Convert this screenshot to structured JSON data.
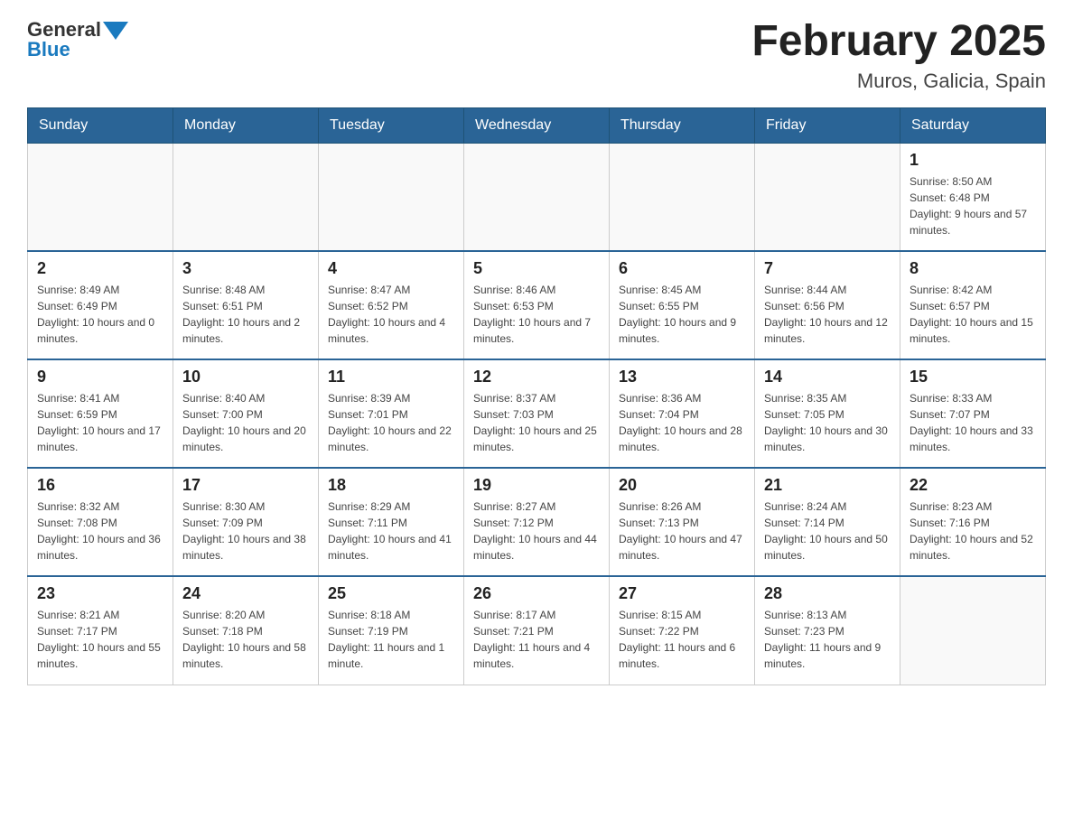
{
  "header": {
    "logo_general": "General",
    "logo_blue": "Blue",
    "title": "February 2025",
    "location": "Muros, Galicia, Spain"
  },
  "weekdays": [
    "Sunday",
    "Monday",
    "Tuesday",
    "Wednesday",
    "Thursday",
    "Friday",
    "Saturday"
  ],
  "weeks": [
    [
      {
        "day": "",
        "info": ""
      },
      {
        "day": "",
        "info": ""
      },
      {
        "day": "",
        "info": ""
      },
      {
        "day": "",
        "info": ""
      },
      {
        "day": "",
        "info": ""
      },
      {
        "day": "",
        "info": ""
      },
      {
        "day": "1",
        "info": "Sunrise: 8:50 AM\nSunset: 6:48 PM\nDaylight: 9 hours and 57 minutes."
      }
    ],
    [
      {
        "day": "2",
        "info": "Sunrise: 8:49 AM\nSunset: 6:49 PM\nDaylight: 10 hours and 0 minutes."
      },
      {
        "day": "3",
        "info": "Sunrise: 8:48 AM\nSunset: 6:51 PM\nDaylight: 10 hours and 2 minutes."
      },
      {
        "day": "4",
        "info": "Sunrise: 8:47 AM\nSunset: 6:52 PM\nDaylight: 10 hours and 4 minutes."
      },
      {
        "day": "5",
        "info": "Sunrise: 8:46 AM\nSunset: 6:53 PM\nDaylight: 10 hours and 7 minutes."
      },
      {
        "day": "6",
        "info": "Sunrise: 8:45 AM\nSunset: 6:55 PM\nDaylight: 10 hours and 9 minutes."
      },
      {
        "day": "7",
        "info": "Sunrise: 8:44 AM\nSunset: 6:56 PM\nDaylight: 10 hours and 12 minutes."
      },
      {
        "day": "8",
        "info": "Sunrise: 8:42 AM\nSunset: 6:57 PM\nDaylight: 10 hours and 15 minutes."
      }
    ],
    [
      {
        "day": "9",
        "info": "Sunrise: 8:41 AM\nSunset: 6:59 PM\nDaylight: 10 hours and 17 minutes."
      },
      {
        "day": "10",
        "info": "Sunrise: 8:40 AM\nSunset: 7:00 PM\nDaylight: 10 hours and 20 minutes."
      },
      {
        "day": "11",
        "info": "Sunrise: 8:39 AM\nSunset: 7:01 PM\nDaylight: 10 hours and 22 minutes."
      },
      {
        "day": "12",
        "info": "Sunrise: 8:37 AM\nSunset: 7:03 PM\nDaylight: 10 hours and 25 minutes."
      },
      {
        "day": "13",
        "info": "Sunrise: 8:36 AM\nSunset: 7:04 PM\nDaylight: 10 hours and 28 minutes."
      },
      {
        "day": "14",
        "info": "Sunrise: 8:35 AM\nSunset: 7:05 PM\nDaylight: 10 hours and 30 minutes."
      },
      {
        "day": "15",
        "info": "Sunrise: 8:33 AM\nSunset: 7:07 PM\nDaylight: 10 hours and 33 minutes."
      }
    ],
    [
      {
        "day": "16",
        "info": "Sunrise: 8:32 AM\nSunset: 7:08 PM\nDaylight: 10 hours and 36 minutes."
      },
      {
        "day": "17",
        "info": "Sunrise: 8:30 AM\nSunset: 7:09 PM\nDaylight: 10 hours and 38 minutes."
      },
      {
        "day": "18",
        "info": "Sunrise: 8:29 AM\nSunset: 7:11 PM\nDaylight: 10 hours and 41 minutes."
      },
      {
        "day": "19",
        "info": "Sunrise: 8:27 AM\nSunset: 7:12 PM\nDaylight: 10 hours and 44 minutes."
      },
      {
        "day": "20",
        "info": "Sunrise: 8:26 AM\nSunset: 7:13 PM\nDaylight: 10 hours and 47 minutes."
      },
      {
        "day": "21",
        "info": "Sunrise: 8:24 AM\nSunset: 7:14 PM\nDaylight: 10 hours and 50 minutes."
      },
      {
        "day": "22",
        "info": "Sunrise: 8:23 AM\nSunset: 7:16 PM\nDaylight: 10 hours and 52 minutes."
      }
    ],
    [
      {
        "day": "23",
        "info": "Sunrise: 8:21 AM\nSunset: 7:17 PM\nDaylight: 10 hours and 55 minutes."
      },
      {
        "day": "24",
        "info": "Sunrise: 8:20 AM\nSunset: 7:18 PM\nDaylight: 10 hours and 58 minutes."
      },
      {
        "day": "25",
        "info": "Sunrise: 8:18 AM\nSunset: 7:19 PM\nDaylight: 11 hours and 1 minute."
      },
      {
        "day": "26",
        "info": "Sunrise: 8:17 AM\nSunset: 7:21 PM\nDaylight: 11 hours and 4 minutes."
      },
      {
        "day": "27",
        "info": "Sunrise: 8:15 AM\nSunset: 7:22 PM\nDaylight: 11 hours and 6 minutes."
      },
      {
        "day": "28",
        "info": "Sunrise: 8:13 AM\nSunset: 7:23 PM\nDaylight: 11 hours and 9 minutes."
      },
      {
        "day": "",
        "info": ""
      }
    ]
  ]
}
